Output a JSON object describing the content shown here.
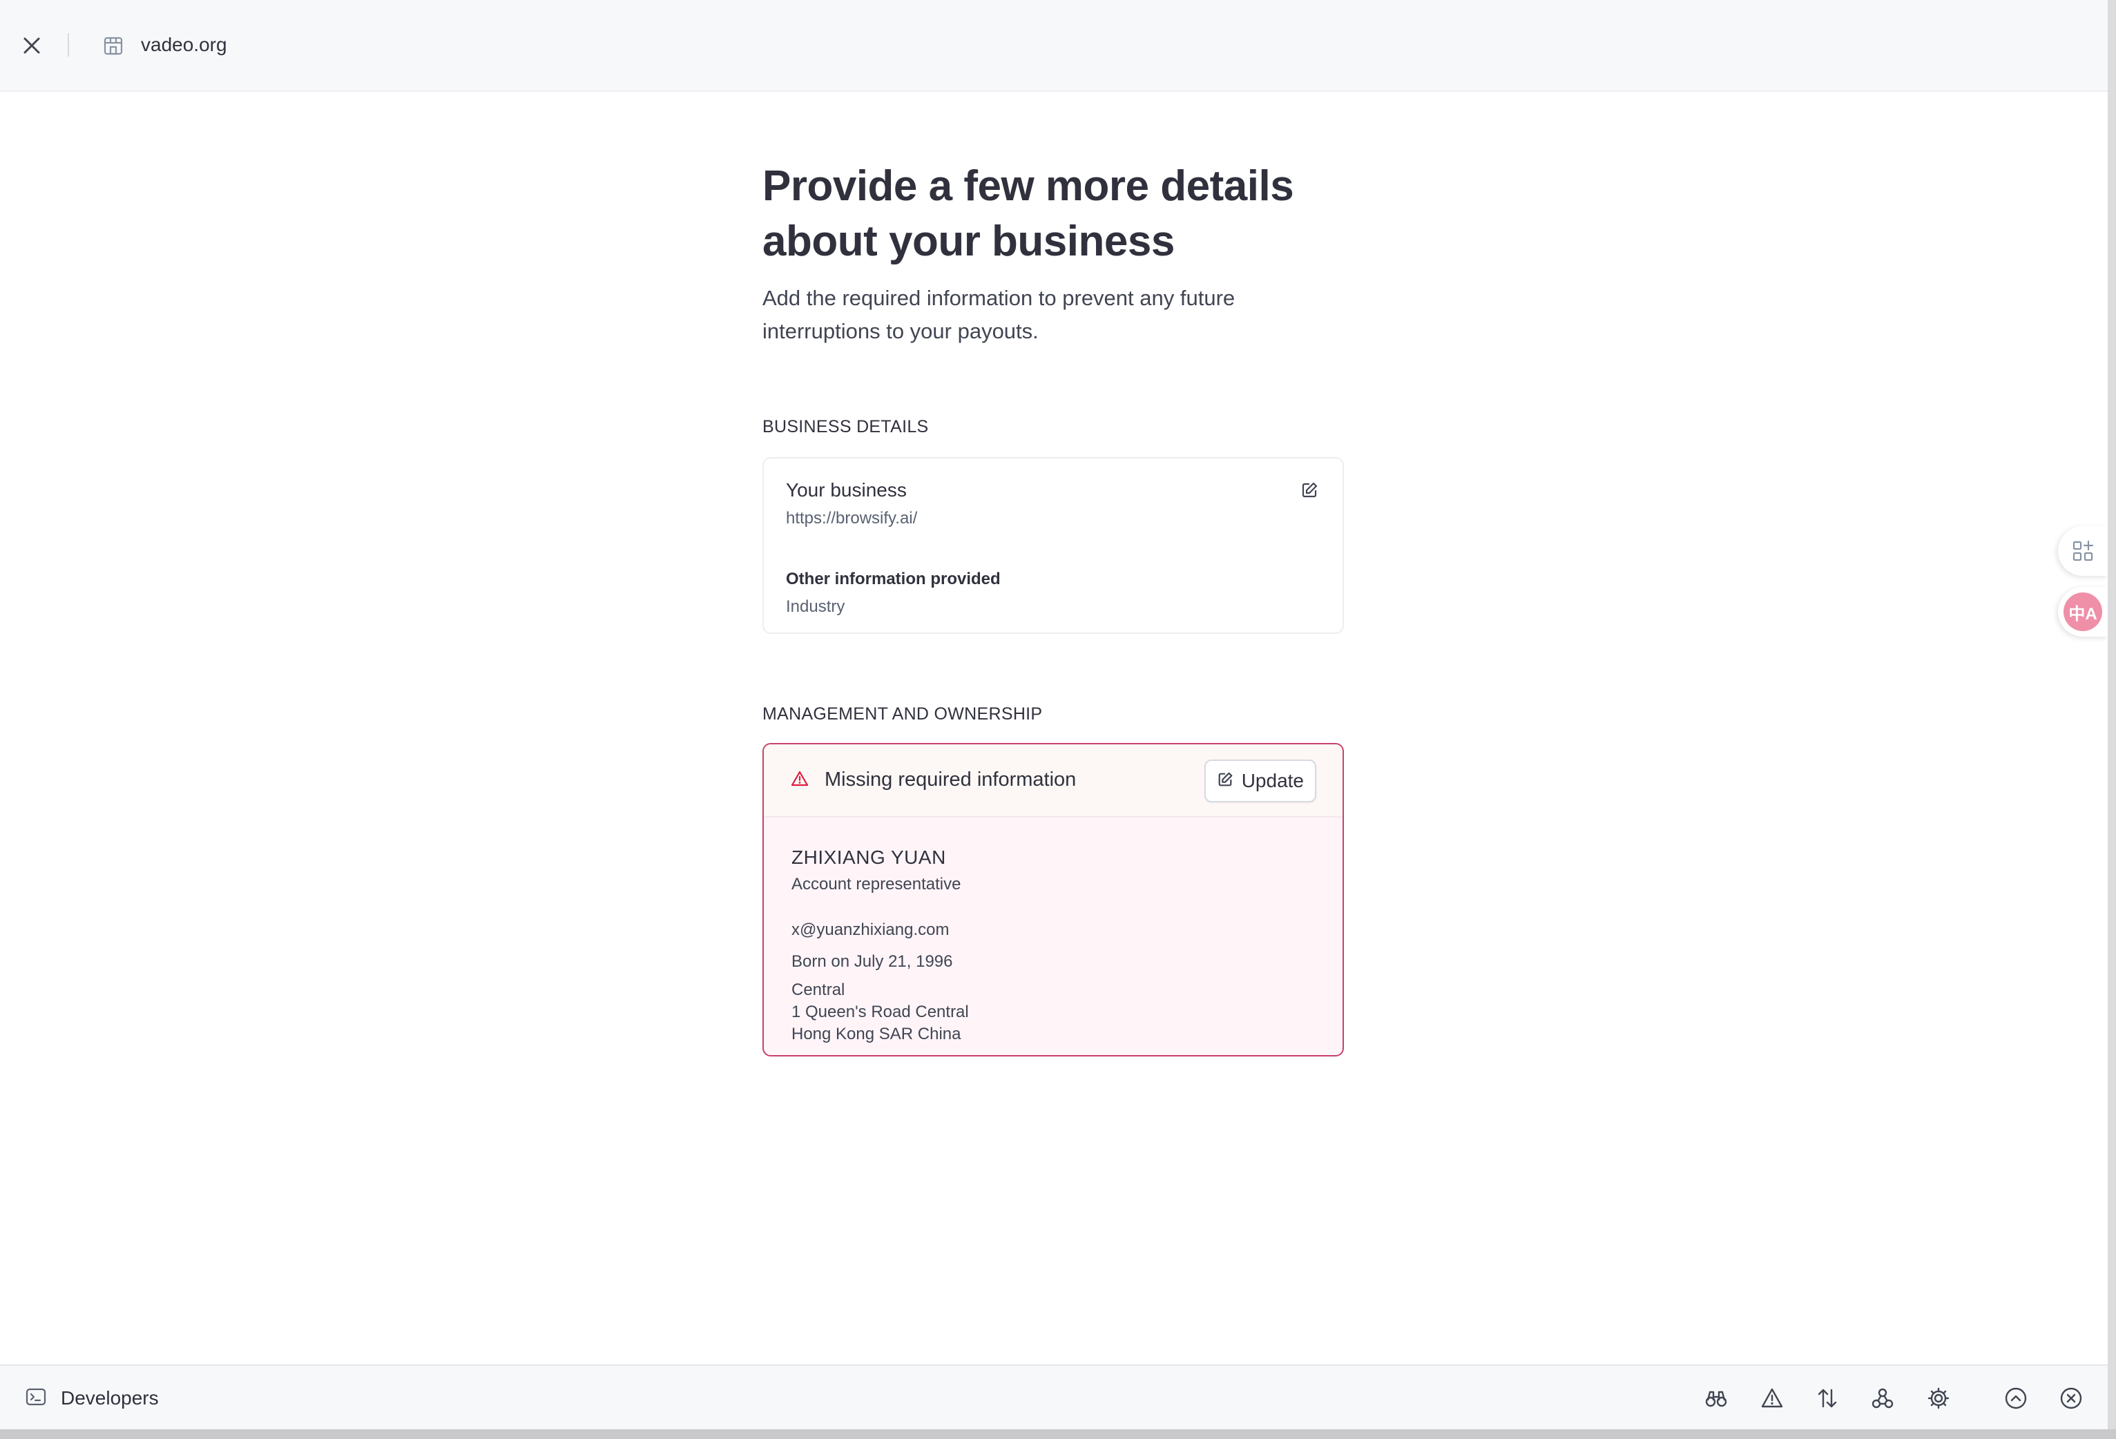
{
  "topbar": {
    "site_name": "vadeo.org",
    "close_icon": "close-icon",
    "store_icon": "store-icon"
  },
  "header": {
    "title_line1": "Provide a few more details",
    "title_line2": "about your business",
    "subtitle_line1": "Add the required information to prevent any future",
    "subtitle_line2": "interruptions to your payouts."
  },
  "business_details": {
    "section_label": "BUSINESS DETAILS",
    "title": "Your business",
    "url": "https://browsify.ai/",
    "other_label": "Other information provided",
    "other_value": "Industry",
    "edit_icon": "edit-icon"
  },
  "management": {
    "section_label": "MANAGEMENT AND OWNERSHIP",
    "warning_text": "Missing required information",
    "update_label": "Update",
    "person": {
      "name": "ZHIXIANG YUAN",
      "role": "Account representative",
      "email": "x@yuanzhixiang.com",
      "dob": "Born on July 21, 1996",
      "address_line1": "Central",
      "address_line2": "1 Queen's Road Central",
      "address_line3": "Hong Kong SAR China"
    }
  },
  "floating": {
    "apps_icon": "apps-add-icon",
    "translate_icon": "translate-icon",
    "translate_glyph": "中A"
  },
  "devbar": {
    "label": "Developers",
    "icons": [
      "binoculars-icon",
      "warning-icon",
      "sort-arrows-icon",
      "webhook-icon",
      "gear-icon",
      "chevron-up-circle-icon",
      "close-circle-icon"
    ]
  },
  "colors": {
    "text_primary": "#30313d",
    "text_secondary": "#596171",
    "danger_border": "#c8416a",
    "danger_bg": "#fff5f9",
    "topbar_bg": "#f7f8f9"
  }
}
